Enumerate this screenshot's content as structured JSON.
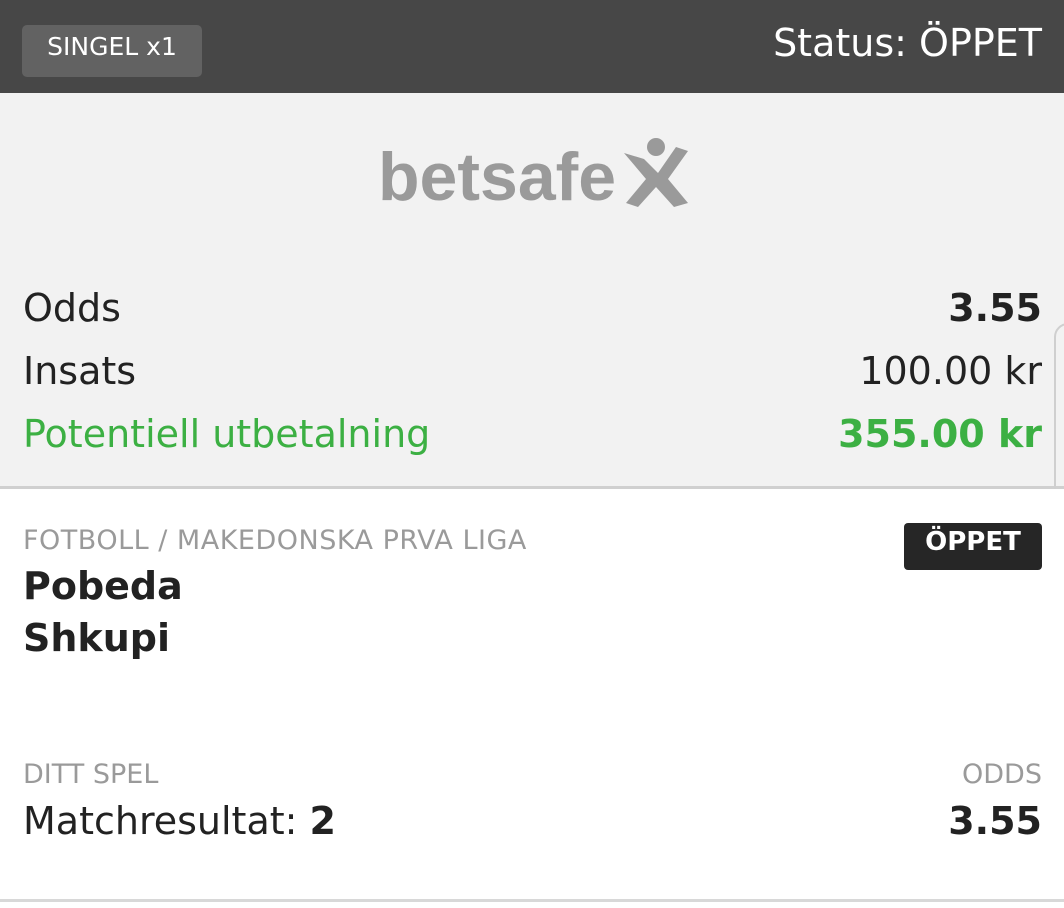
{
  "header": {
    "bet_type": "SINGEL x1",
    "status": "Status: ÖPPET"
  },
  "brand": {
    "logo_text": "betsafe",
    "logo_color": "#9a9a9a"
  },
  "summary": {
    "odds_label": "Odds",
    "odds_value": "3.55",
    "stake_label": "Insats",
    "stake_value": "100.00 kr",
    "payout_label": "Potentiell utbetalning",
    "payout_value": "355.00 kr",
    "payout_color": "#3cb043"
  },
  "selection": {
    "competition": "FOTBOLL / MAKEDONSKA PRVA LIGA",
    "state_badge": "ÖPPET",
    "home_team": "Pobeda",
    "away_team": "Shkupi",
    "bet_label": "DITT SPEL",
    "odds_label": "ODDS",
    "market": "Matchresultat: ",
    "pick": "2",
    "odds": "3.55"
  }
}
